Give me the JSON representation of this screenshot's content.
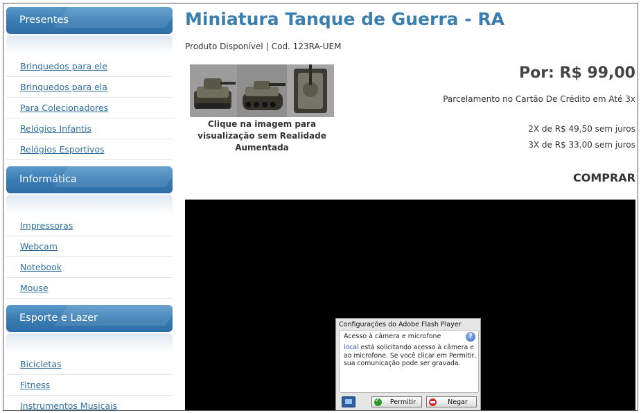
{
  "sidebar": {
    "categories": [
      {
        "title": "Presentes",
        "items": [
          "Brinquedos para ele",
          "Brinquedos para ela",
          "Para Colecionadores",
          "Relógios Infantis",
          "Relógios Esportivos"
        ]
      },
      {
        "title": "Informática",
        "items": [
          "Impressoras",
          "Webcam",
          "Notebook",
          "Mouse"
        ]
      },
      {
        "title": "Esporte e Lazer",
        "items": [
          "Bicicletas",
          "Fitness",
          "Instrumentos Musicais"
        ]
      }
    ]
  },
  "product": {
    "title": "Miniatura Tanque de Guerra - RA",
    "availability": "Produto Disponível",
    "separator": "|",
    "code": "Cod. 123RA-UEM",
    "image_caption": "Clique na imagem para visualização sem Realidade Aumentada",
    "price": "Por: R$ 99,00",
    "installments_note": "Parcelamento no Cartão De Crédito em Até 3x",
    "installment_2x": "2X de R$ 49,50 sem juros",
    "installment_3x": "3X de R$ 33,00 sem juros",
    "buy_label": "COMPRAR"
  },
  "flash_dialog": {
    "title": "Configurações do Adobe Flash Player",
    "heading": "Acesso à câmera e microfone",
    "help_icon": "question-mark-icon",
    "text_link": "local",
    "text_body": " está solicitando acesso à câmera e ao microfone. Se você clicar em Permitir, sua comunicação pode ser gravada.",
    "allow_label": "Permitir",
    "deny_label": "Negar",
    "camera_icon": "monitor-camera-icon"
  },
  "colors": {
    "title_blue": "#3a7fae",
    "link_blue": "#2e6e9e",
    "header_blue": "#3a7db4",
    "player_bg": "#000000"
  }
}
